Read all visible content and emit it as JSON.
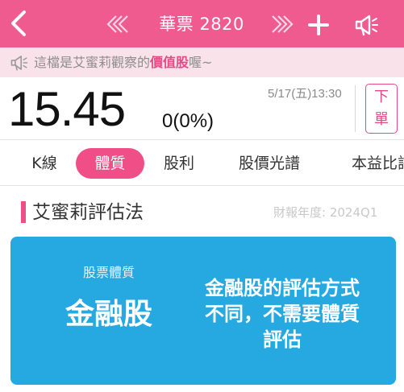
{
  "header": {
    "title": "華票 2820",
    "icons": {
      "back": "chevron-left-icon",
      "prev": "double-chevron-left-icon",
      "next": "double-chevron-right-icon",
      "add": "plus-icon",
      "speaker": "megaphone-icon"
    },
    "background": "#ef5b8e"
  },
  "notice": {
    "prefix": "這檔是艾蜜莉觀察的",
    "highlight": "價值股",
    "suffix": "喔~",
    "icon": "megaphone-icon"
  },
  "quote": {
    "price": "15.45",
    "change": "0(0%)",
    "time": "5/17(五)13:30",
    "order_button": [
      "下",
      "單"
    ]
  },
  "tabs": [
    {
      "label": "K線",
      "active": false
    },
    {
      "label": "體質",
      "active": true
    },
    {
      "label": "股利",
      "active": false
    },
    {
      "label": "股價光譜",
      "active": false
    },
    {
      "label": "本益比評",
      "active": false
    }
  ],
  "section": {
    "title": "艾蜜莉評估法",
    "fiscal_year": "財報年度: 2024Q1"
  },
  "card": {
    "label": "股票體質",
    "type": "金融股",
    "description": "金融股的評估方式不同，不需要體質評估",
    "color": "#26a9e1"
  }
}
